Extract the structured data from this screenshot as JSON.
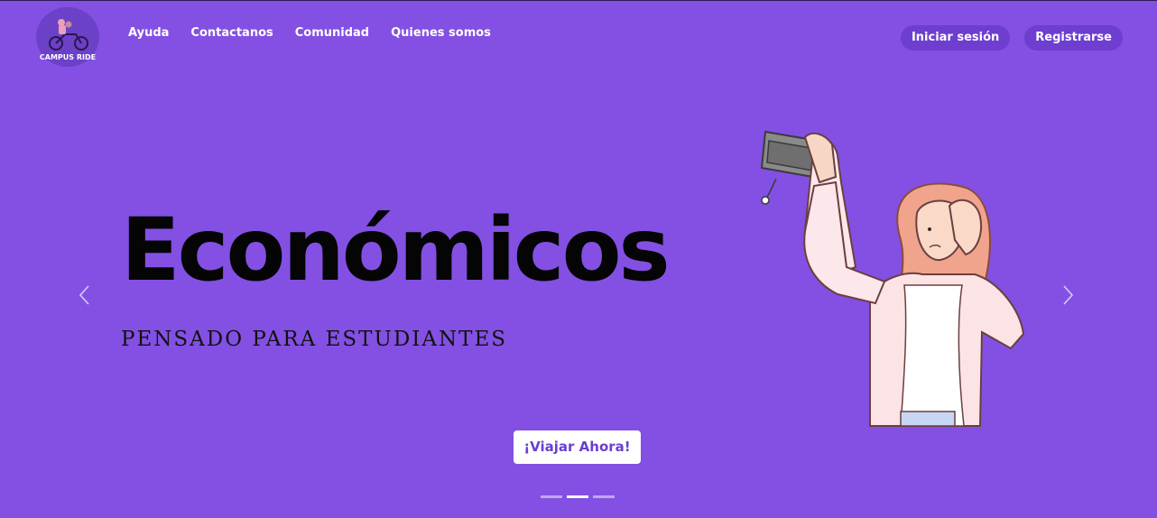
{
  "brand": {
    "logo_text": "CAMPUS RIDE"
  },
  "nav": {
    "items": [
      {
        "label": "Ayuda"
      },
      {
        "label": "Contactanos"
      },
      {
        "label": "Comunidad"
      },
      {
        "label": "Quienes somos"
      }
    ]
  },
  "auth": {
    "login": "Iniciar sesión",
    "register": "Registrarse"
  },
  "hero": {
    "title": "Económicos",
    "subtitle": "PENSADO PARA ESTUDIANTES",
    "cta": "¡Viajar Ahora!"
  },
  "carousel": {
    "slide_count": 3,
    "active_index": 1
  },
  "colors": {
    "background": "#8350e3",
    "pill": "#6d3ed0",
    "cta_text": "#6a3fd0"
  },
  "icons": {
    "prev": "chevron-left-icon",
    "next": "chevron-right-icon"
  }
}
